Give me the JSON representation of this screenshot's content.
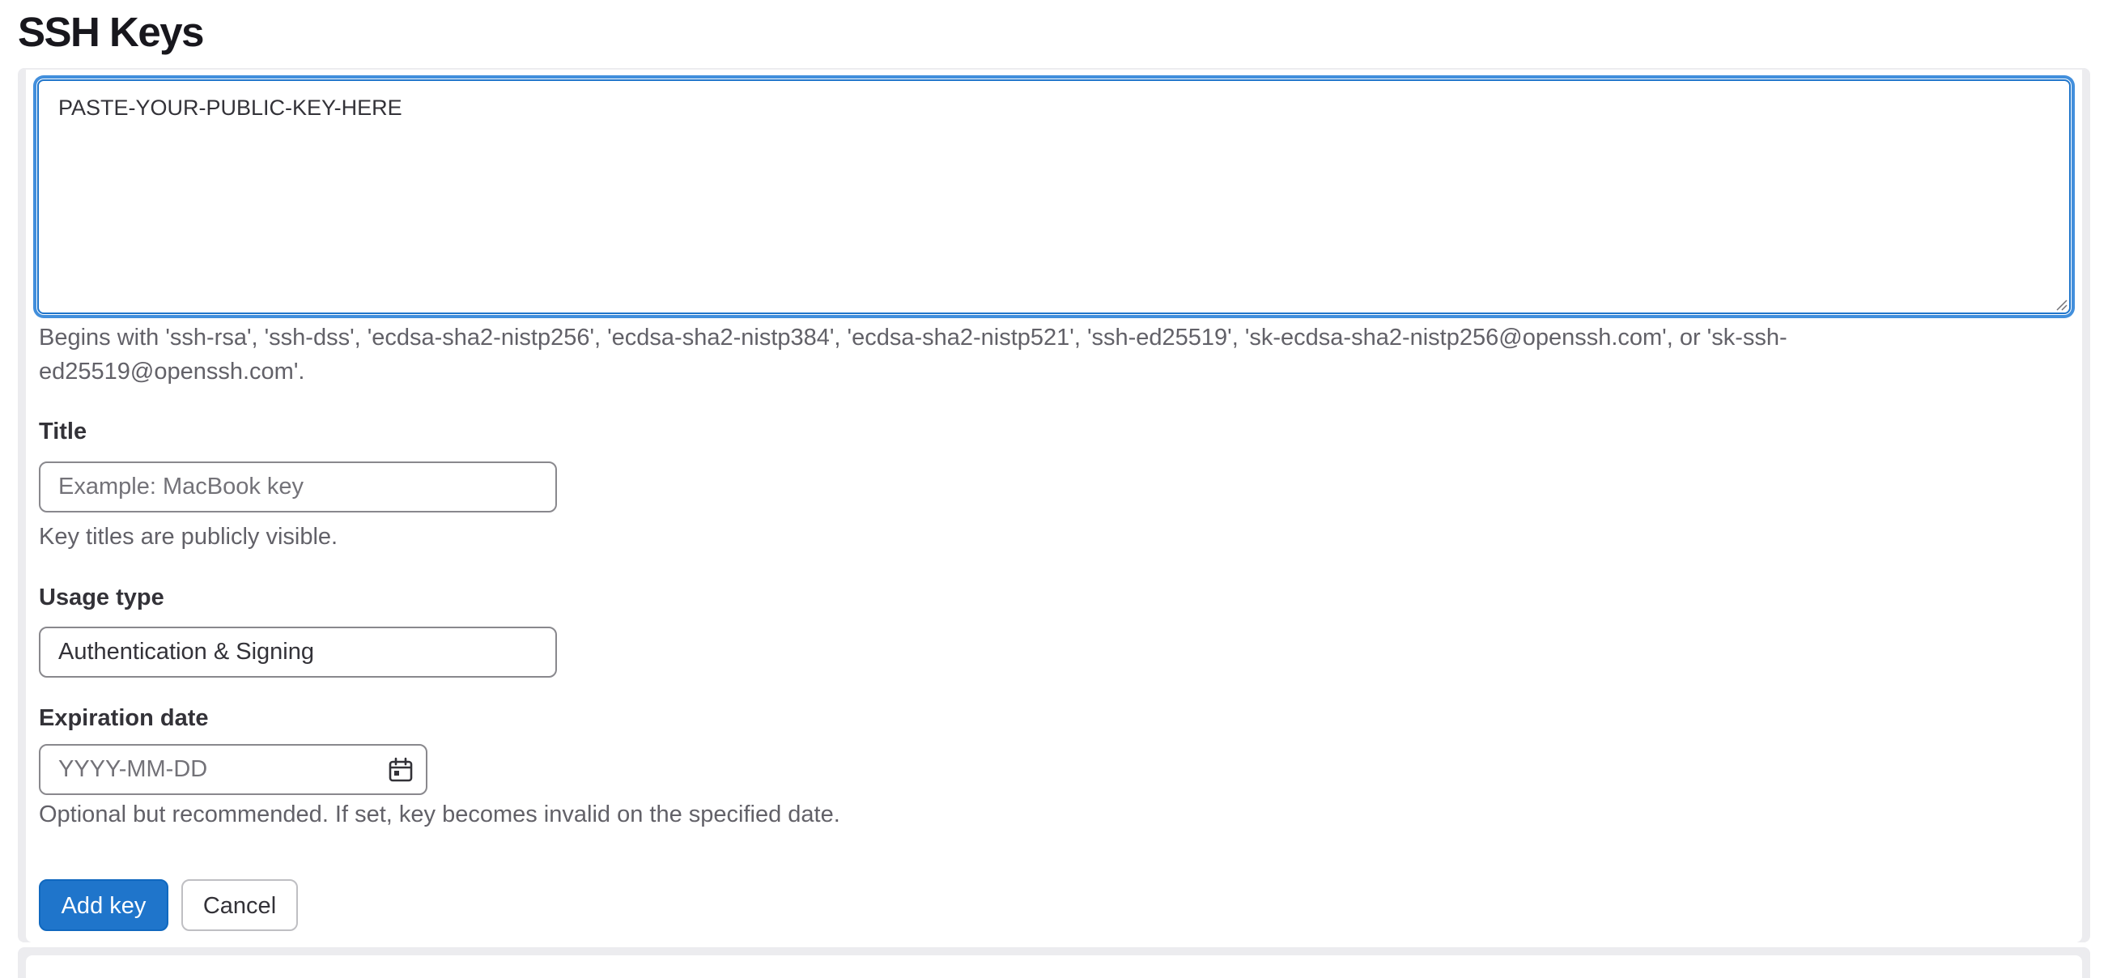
{
  "page": {
    "title": "SSH Keys"
  },
  "form": {
    "key": {
      "value": "PASTE-YOUR-PUBLIC-KEY-HERE",
      "help_line1": "Begins with 'ssh-rsa', 'ssh-dss', 'ecdsa-sha2-nistp256', 'ecdsa-sha2-nistp384', 'ecdsa-sha2-nistp521', 'ssh-ed25519', 'sk-ecdsa-sha2-nistp256@openssh.com', or 'sk-ssh-",
      "help_line2": "ed25519@openssh.com'."
    },
    "title": {
      "label": "Title",
      "placeholder": "Example: MacBook key",
      "value": "",
      "help": "Key titles are publicly visible."
    },
    "usage_type": {
      "label": "Usage type",
      "selected": "Authentication & Signing"
    },
    "expiration": {
      "label": "Expiration date",
      "placeholder": "YYYY-MM-DD",
      "value": "",
      "icon": "calendar-icon",
      "help": "Optional but recommended. If set, key becomes invalid on the specified date."
    },
    "actions": {
      "add_label": "Add key",
      "cancel_label": "Cancel"
    }
  },
  "colors": {
    "primary": "#1f75cb",
    "focus_ring": "#428fdc",
    "text": "#333238",
    "muted_text": "#626168",
    "border": "#89888d",
    "panel_bg": "#ececef"
  }
}
